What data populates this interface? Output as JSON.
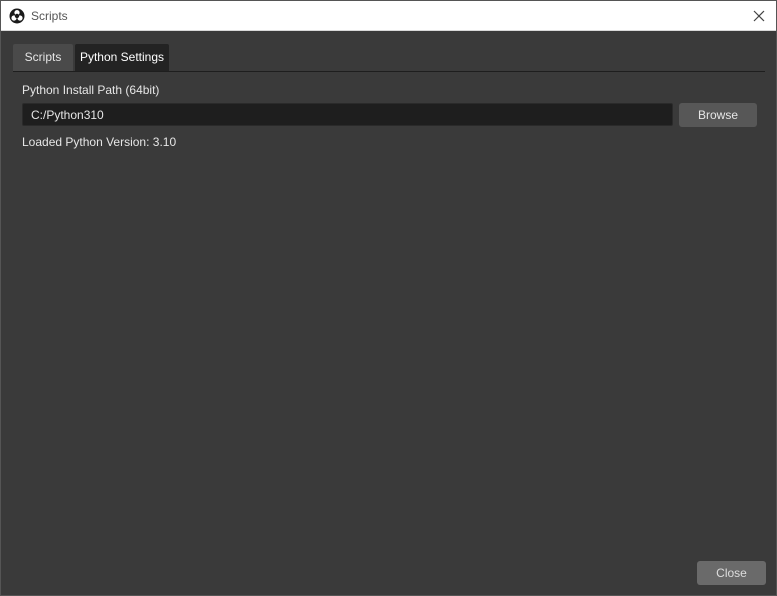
{
  "window": {
    "title": "Scripts",
    "icon": "obs-logo-icon",
    "close_icon": "close-icon"
  },
  "tabs": [
    {
      "label": "Scripts",
      "active": false
    },
    {
      "label": "Python Settings",
      "active": true
    }
  ],
  "python_settings": {
    "install_path_label": "Python Install Path (64bit)",
    "install_path_value": "C:/Python310",
    "browse_label": "Browse",
    "loaded_version": "Loaded Python Version: 3.10"
  },
  "footer": {
    "close_label": "Close"
  },
  "colors": {
    "background": "#3a3a3a",
    "input_bg": "#1e1e1e",
    "active_tab": "#232323",
    "button": "#575757"
  }
}
